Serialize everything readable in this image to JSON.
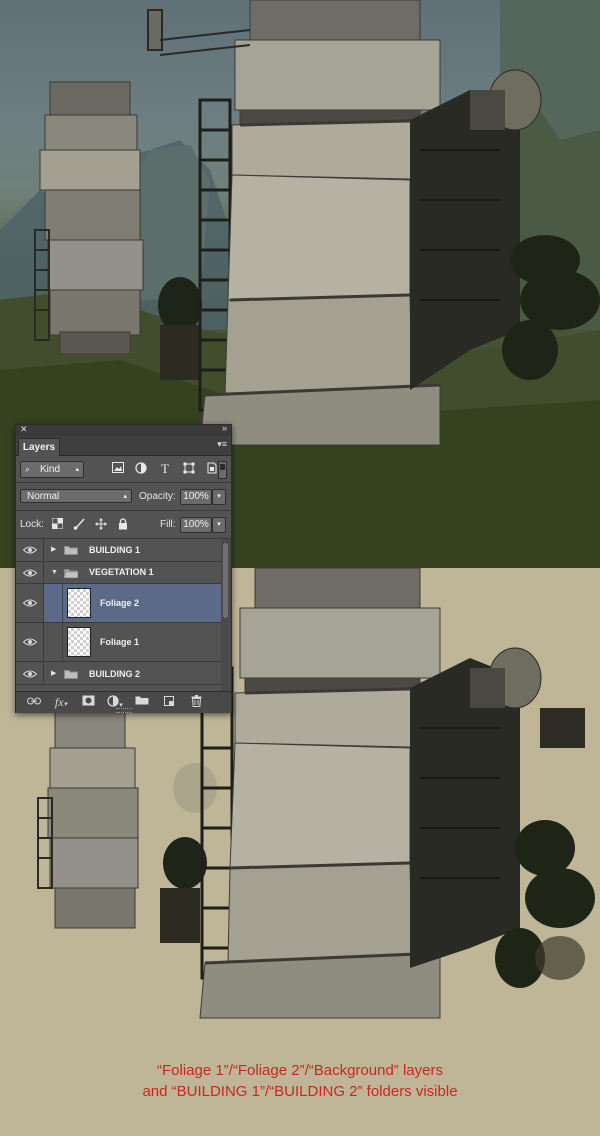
{
  "panel": {
    "tab_label": "Layers",
    "filter": {
      "kind_label": "Kind"
    },
    "blend_mode": "Normal",
    "opacity_label": "Opacity:",
    "opacity_value": "100%",
    "lock_label": "Lock:",
    "fill_label": "Fill:",
    "fill_value": "100%",
    "layers": [
      {
        "name": "BUILDING 1",
        "type": "folder",
        "expanded": false,
        "visible": true,
        "selected": false
      },
      {
        "name": "VEGETATION 1",
        "type": "folder",
        "expanded": true,
        "visible": true,
        "selected": false
      },
      {
        "name": "Foliage 2",
        "type": "layer",
        "visible": true,
        "selected": true
      },
      {
        "name": "Foliage 1",
        "type": "layer",
        "visible": true,
        "selected": false
      },
      {
        "name": "BUILDING 2",
        "type": "folder",
        "expanded": false,
        "visible": true,
        "selected": false
      }
    ],
    "footer_icons": [
      "link-icon",
      "fx-icon",
      "mask-icon",
      "adjustment-icon",
      "folder-icon",
      "new-layer-icon",
      "trash-icon"
    ]
  },
  "caption": {
    "line1": "“Foliage 1”/“Foliage 2”/“Background” layers",
    "line2": "and “BUILDING 1”/“BUILDING 2” folders visible",
    "color": "#c8281e"
  },
  "colors": {
    "panel_bg": "#535353",
    "selected_row": "#5a6a88",
    "canvas_bg": "#bfb597"
  }
}
